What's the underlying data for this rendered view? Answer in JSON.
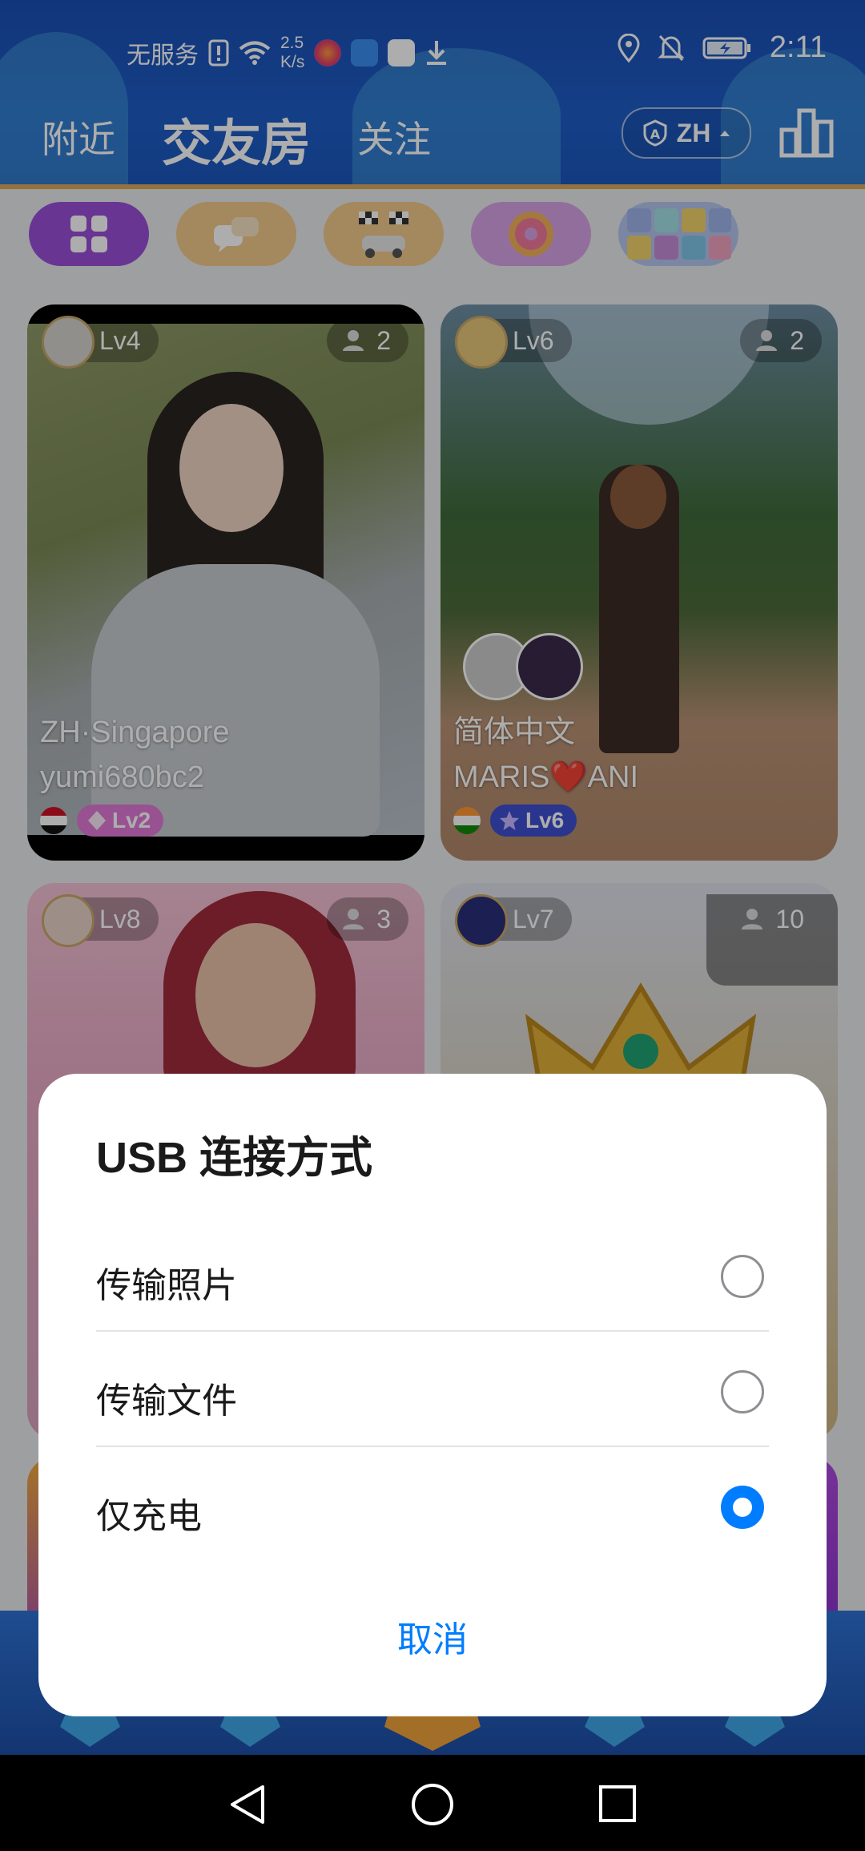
{
  "status_bar": {
    "carrier": "无服务",
    "speed_value": "2.5",
    "speed_unit": "K/s",
    "time": "2:11",
    "icons": [
      "sim-alert-icon",
      "wifi-icon",
      "app-icon",
      "app-icon",
      "huawei-icon",
      "download-icon",
      "location-icon",
      "mute-icon",
      "battery-icon"
    ]
  },
  "top_nav": {
    "tabs": [
      "附近",
      "交友房",
      "关注"
    ],
    "active_tab": "交友房",
    "language": "ZH"
  },
  "filters": [
    {
      "icon": "grid-icon",
      "color": "#9b4fd9"
    },
    {
      "icon": "chat-icon",
      "color": "#f2c98b"
    },
    {
      "icon": "race-icon",
      "color": "#f2c98b"
    },
    {
      "icon": "donut-icon",
      "color": "#d7a2e8"
    },
    {
      "icon": "number-puzzle-icon",
      "color": "#b6c6ef"
    }
  ],
  "rooms": [
    {
      "level": "Lv4",
      "count": "2",
      "line1": "ZH·Singapore",
      "line2": "yumi680bc2",
      "badge": "Lv2",
      "badge_color": "#e07ad8"
    },
    {
      "level": "Lv6",
      "count": "2",
      "line1": "简体中文",
      "line2": "MARIS❤️ANI",
      "badge": "Lv6",
      "badge_color": "#3e4fd1"
    },
    {
      "level": "Lv8",
      "count": "3"
    },
    {
      "level": "Lv7",
      "count": "10"
    }
  ],
  "dialog": {
    "title": "USB 连接方式",
    "options": [
      {
        "label": "传输照片",
        "selected": false
      },
      {
        "label": "传输文件",
        "selected": false
      },
      {
        "label": "仅充电",
        "selected": true
      }
    ],
    "cancel": "取消"
  },
  "colors": {
    "accent": "#007dff",
    "header": "#1e5dc7"
  }
}
